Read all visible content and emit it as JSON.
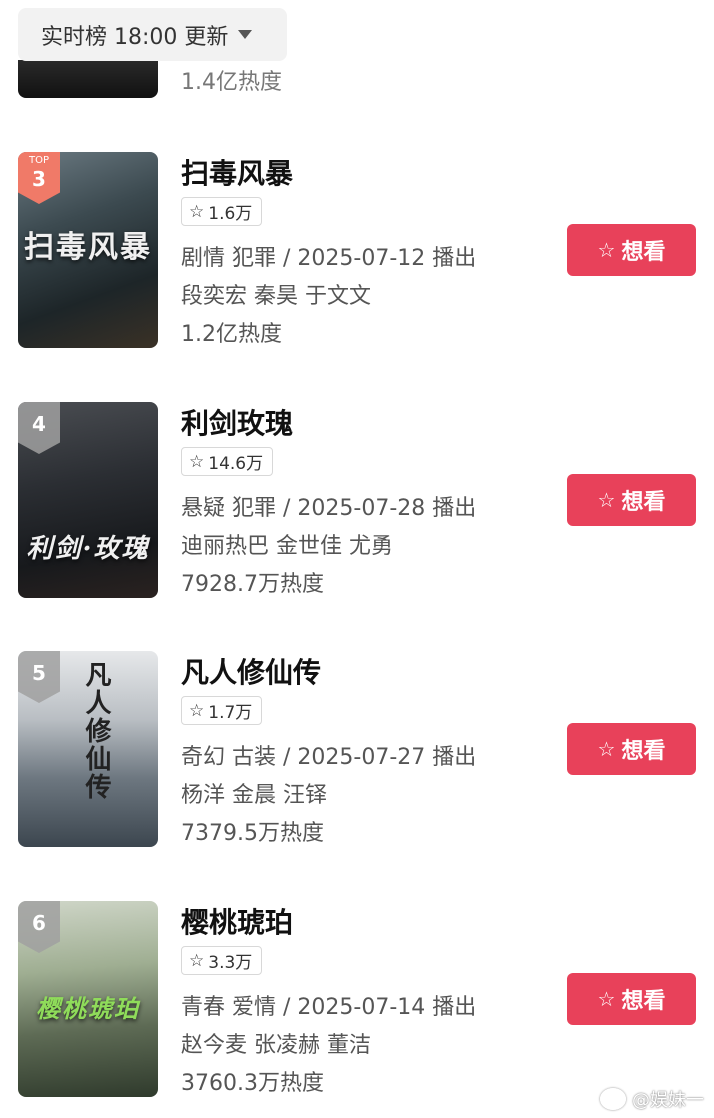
{
  "topbar": {
    "label": "实时榜 18:00 更新"
  },
  "peek": {
    "heat": "1.4亿热度"
  },
  "items": [
    {
      "top_label": "TOP",
      "rank": "3",
      "poster_title": "扫毒风暴",
      "title": "扫毒风暴",
      "rating": "1.6万",
      "genre": "剧情 犯罪 / 2025-07-12 播出",
      "cast": "段奕宏 秦昊 于文文",
      "heat": "1.2亿热度",
      "button": "想看"
    },
    {
      "rank": "4",
      "poster_title": "利剑·玫瑰",
      "title": "利剑玫瑰",
      "rating": "14.6万",
      "genre": "悬疑 犯罪 / 2025-07-28 播出",
      "cast": "迪丽热巴 金世佳 尤勇",
      "heat": "7928.7万热度",
      "button": "想看"
    },
    {
      "rank": "5",
      "poster_title": "凡人修仙传",
      "title": "凡人修仙传",
      "rating": "1.7万",
      "genre": "奇幻 古装 / 2025-07-27 播出",
      "cast": "杨洋 金晨 汪铎",
      "heat": "7379.5万热度",
      "button": "想看"
    },
    {
      "rank": "6",
      "poster_title": "樱桃琥珀",
      "title": "樱桃琥珀",
      "rating": "3.3万",
      "genre": "青春 爱情 / 2025-07-14 播出",
      "cast": "赵今麦 张凌赫 董洁",
      "heat": "3760.3万热度",
      "button": "想看"
    }
  ],
  "watermark": "@娱妹一",
  "icons": {
    "star": "star-outline-icon",
    "caret": "caret-down-icon",
    "weibo": "weibo-icon"
  },
  "colors": {
    "accent": "#e8415a",
    "top_badge": "#f07a68"
  }
}
